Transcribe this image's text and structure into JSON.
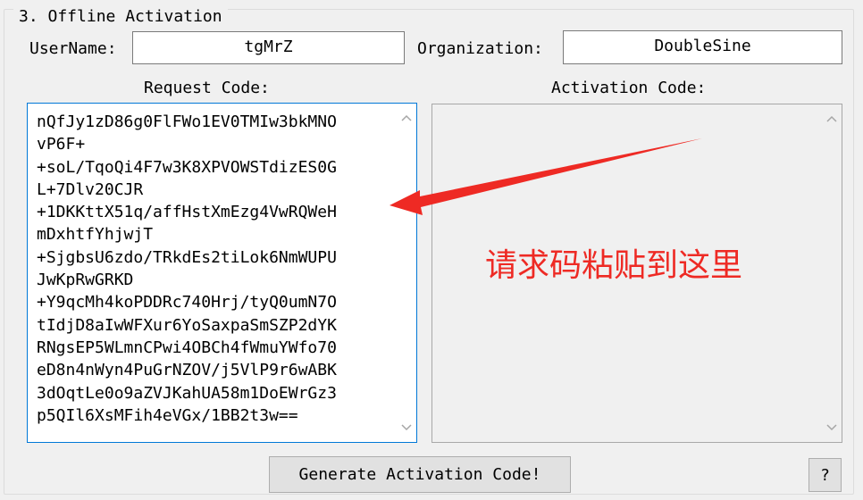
{
  "group": {
    "title": "3. Offline Activation"
  },
  "form": {
    "username_label": "UserName:",
    "username_value": "tgMrZ",
    "organization_label": "Organization:",
    "organization_value": "DoubleSine"
  },
  "request": {
    "label": "Request Code:",
    "lines": [
      "nQfJy1zD86g0FlFWo1EV0TMIw3bkMNO",
      "vP6F+",
      "+soL/TqoQi4F7w3K8XPVOWSTdizES0G",
      "L+7Dlv20CJR",
      "+1DKKttX51q/affHstXmEzg4VwRQWeH",
      "mDxhtfYhjwjT",
      "+SjgbsU6zdo/TRkdEs2tiLok6NmWUPU",
      "JwKpRwGRKD",
      "+Y9qcMh4koPDDRc740Hrj/tyQ0umN7O",
      "tIdjD8aIwWFXur6YoSaxpaSmSZP2dYK",
      "RNgsEP5WLmnCPwi4OBCh4fWmuYWfo70",
      "eD8n4nWyn4PuGrNZOV/j5VlP9r6wABK",
      "3dOqtLe0o9aZVJKahUA58m1DoEWrGz3",
      "p5QIl6XsMFih4eVGx/1BB2t3w=="
    ]
  },
  "activation": {
    "label": "Activation Code:",
    "value": ""
  },
  "annotation": {
    "text": "请求码粘贴到这里",
    "color": "#ee2a24"
  },
  "buttons": {
    "generate": "Generate Activation Code!",
    "help": "?"
  },
  "icons": {
    "scroll_up": "chevron-up-icon",
    "scroll_down": "chevron-down-icon",
    "arrow": "red-arrow-icon"
  }
}
